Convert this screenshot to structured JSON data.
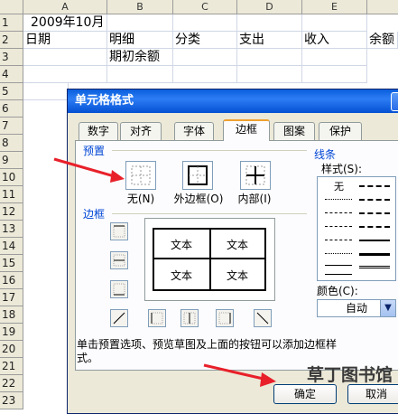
{
  "spreadsheet": {
    "columns": [
      "A",
      "B",
      "C",
      "D",
      "E"
    ],
    "rows": [
      "1",
      "2",
      "3",
      "4",
      "5",
      "6",
      "7",
      "8",
      "9",
      "10",
      "11",
      "12",
      "13",
      "14",
      "15",
      "16",
      "17",
      "18",
      "19",
      "20",
      "21",
      "22",
      "23"
    ],
    "cells": {
      "a1": "2009年10月",
      "a2": "日期",
      "b2": "明细",
      "c2": "分类",
      "d2": "支出",
      "e2": "收入",
      "f2": "余额",
      "b3": "期初余额"
    }
  },
  "dialog": {
    "title": "单元格格式",
    "help": "?",
    "tabs": [
      "数字",
      "对齐",
      "字体",
      "边框",
      "图案",
      "保护"
    ],
    "active_tab": "边框",
    "preset_label": "预置",
    "presets": [
      {
        "label": "无(N)",
        "icon": "no-border-icon"
      },
      {
        "label": "外边框(O)",
        "icon": "outline-border-icon"
      },
      {
        "label": "内部(I)",
        "icon": "inside-border-icon"
      }
    ],
    "border_label": "边框",
    "preview_text": [
      "文本",
      "文本",
      "文本",
      "文本"
    ],
    "line_label": "线条",
    "style_label": "样式(S):",
    "style_none": "无",
    "color_label": "颜色(C):",
    "color_value": "自动",
    "hint": "单击预置选项、预览草图及上面的按钮可以添加边框样式。",
    "ok": "确定",
    "cancel": "取消",
    "accent_color": "#0a5fdc",
    "arrow_color": "#e8202a"
  },
  "watermark": "草丁图书馆"
}
